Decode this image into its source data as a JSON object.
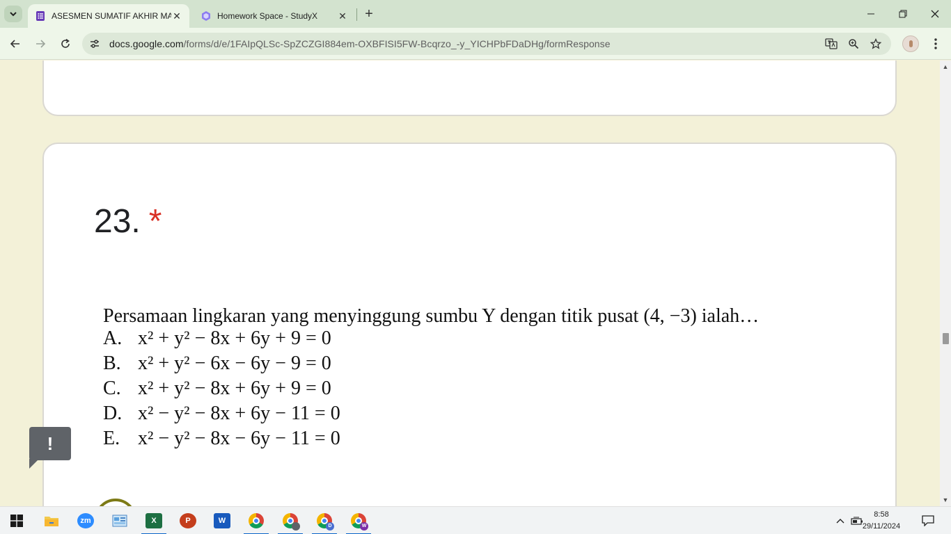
{
  "browser": {
    "tabs": [
      {
        "title": "ASESMEN SUMATIF AKHIR MAT",
        "icon": "google-forms-icon",
        "active": true
      },
      {
        "title": "Homework Space - StudyX",
        "icon": "studyx-icon",
        "active": false
      }
    ],
    "url_host": "docs.google.com",
    "url_path": "/forms/d/e/1FAIpQLSc-SpZCZGI884em-OXBFISI5FW-Bcqrzo_-y_YICHPbFDaDHg/formResponse"
  },
  "question": {
    "number": "23.",
    "required_mark": "*",
    "stem": "Persamaan lingkaran yang menyinggung sumbu Y dengan titik pusat (4, −3) ialah…",
    "options": [
      {
        "letter": "A.",
        "equation": "x² + y² − 8x + 6y + 9 = 0"
      },
      {
        "letter": "B.",
        "equation": "x² + y² − 6x − 6y − 9 = 0"
      },
      {
        "letter": "C.",
        "equation": "x² + y² − 8x + 6y + 9 = 0"
      },
      {
        "letter": "D.",
        "equation": "x² − y² − 8x + 6y − 11 = 0"
      },
      {
        "letter": "E.",
        "equation": "x² − y² − 8x − 6y − 11 = 0"
      }
    ]
  },
  "feedback_button": {
    "label": "!"
  },
  "taskbar": {
    "apps": [
      "windows-start",
      "file-explorer",
      "zoom",
      "control-panel",
      "excel",
      "powerpoint",
      "word",
      "chrome",
      "chrome-profile-2",
      "chrome-profile-d",
      "chrome-profile-w"
    ],
    "zoom_label": "zm",
    "excel_label": "X",
    "powerpoint_label": "P",
    "word_label": "W",
    "chrome_d_badge": "D",
    "chrome_w_badge": "W",
    "time": "8:58",
    "date": "29/11/2024"
  },
  "colors": {
    "page_background": "#f3f1d8",
    "required": "#d93025",
    "radio_accent": "#7d7a16",
    "tab_strip": "#d3e3cf"
  }
}
